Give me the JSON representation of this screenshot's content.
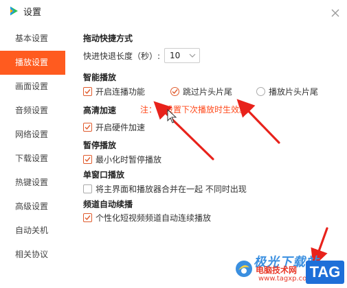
{
  "app": {
    "title": "设置"
  },
  "sidebar": {
    "items": [
      {
        "label": "基本设置",
        "active": false
      },
      {
        "label": "播放设置",
        "active": true
      },
      {
        "label": "画面设置",
        "active": false
      },
      {
        "label": "音频设置",
        "active": false
      },
      {
        "label": "网络设置",
        "active": false
      },
      {
        "label": "下载设置",
        "active": false
      },
      {
        "label": "热键设置",
        "active": false
      },
      {
        "label": "高级设置",
        "active": false
      },
      {
        "label": "自动关机",
        "active": false
      },
      {
        "label": "相关协议",
        "active": false
      }
    ]
  },
  "drag_seek": {
    "title": "拖动快捷方式",
    "length_label": "快进快退长度（秒）:",
    "length_value": "10"
  },
  "smart_play": {
    "title": "智能播放",
    "continuous_label": "开启连播功能",
    "continuous_checked": true,
    "skip_label": "跳过片头片尾",
    "skip_selected": true,
    "play_label": "播放片头片尾",
    "play_selected": false
  },
  "hd_accel": {
    "title": "高清加速",
    "hint": "注：该设置下次播放时生效。",
    "hw_label": "开启硬件加速",
    "hw_checked": true
  },
  "pause_play": {
    "title": "暂停播放",
    "minimize_label": "最小化时暂停播放",
    "minimize_checked": true
  },
  "single_window": {
    "title": "单窗口播放",
    "merge_label": "将主界面和播放器合并在一起 不同时出现",
    "merge_checked": false
  },
  "channel_auto": {
    "title": "频道自动续播",
    "personal_label": "个性化短视频频道自动连续播放",
    "personal_checked": true
  },
  "watermark": {
    "line1": "极光下载站",
    "line2": "电脑技术网",
    "line3": "www.tagxp.com",
    "tag": "TAG"
  },
  "colors": {
    "accent": "#ff5b1f",
    "check": "#e05a2b",
    "arrow": "#e8221b",
    "hint": "#ff4a1c"
  }
}
